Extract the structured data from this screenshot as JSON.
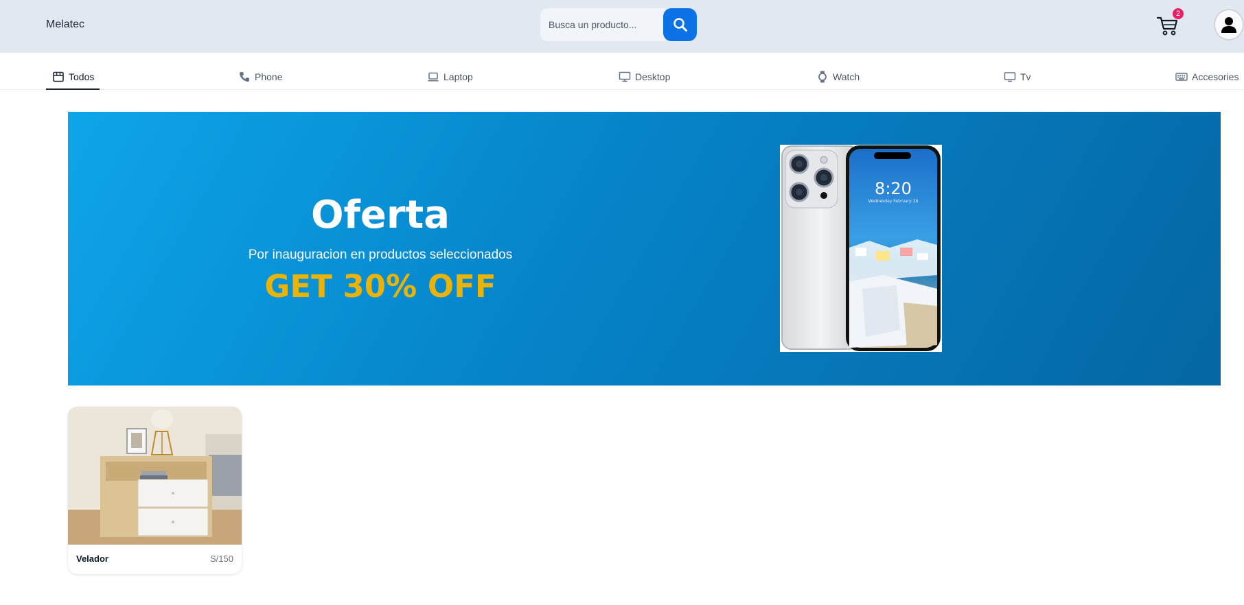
{
  "header": {
    "brand": "Melatec",
    "search_placeholder": "Busca un producto...",
    "search_icon": "search-icon",
    "cart_icon": "cart-icon",
    "cart_count": "2",
    "avatar_icon": "user-icon"
  },
  "categories": [
    {
      "label": "Todos",
      "icon": "store-icon",
      "active": true
    },
    {
      "label": "Phone",
      "icon": "phone-icon"
    },
    {
      "label": "Laptop",
      "icon": "laptop-icon"
    },
    {
      "label": "Desktop",
      "icon": "desktop-icon"
    },
    {
      "label": "Watch",
      "icon": "watch-icon"
    },
    {
      "label": "Tv",
      "icon": "tv-icon"
    },
    {
      "label": "Accesories",
      "icon": "keyboard-icon"
    }
  ],
  "banner": {
    "title": "Oferta",
    "subtitle": "Por inauguracion en productos seleccionados",
    "discount": "GET 30% OFF",
    "image": "smartphone-image",
    "phone_time": "8:20",
    "phone_date": "Wednesday February 26"
  },
  "products": [
    {
      "name": "Velador",
      "price": "S/150",
      "image": "nightstand-image"
    }
  ],
  "colors": {
    "header_bg": "#e2e8f0",
    "search_button": "#0b73e6",
    "banner_start": "#0ea5e9",
    "banner_end": "#0567a3",
    "discount": "#eab308",
    "badge": "#e91e63"
  }
}
